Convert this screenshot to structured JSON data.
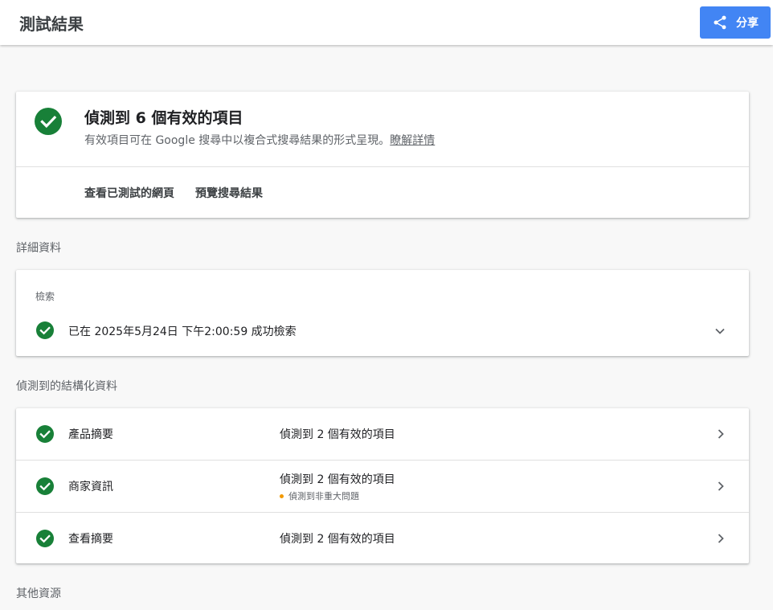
{
  "header": {
    "title": "測試結果",
    "share_label": "分享"
  },
  "summary": {
    "headline": "偵測到 6 個有效的項目",
    "description": "有效項目可在 Google 搜尋中以複合式搜尋結果的形式呈現。",
    "learn_more": "瞭解詳情",
    "actions": [
      "查看已測試的網頁",
      "預覽搜尋結果"
    ]
  },
  "details": {
    "section_label": "詳細資料",
    "crawl_label": "檢索",
    "crawl_status": "已在 2025年5月24日 下午2:00:59 成功檢索"
  },
  "structured_data": {
    "section_label": "偵測到的結構化資料",
    "rows": [
      {
        "name": "產品摘要",
        "status": "偵測到 2 個有效的項目",
        "warning": ""
      },
      {
        "name": "商家資訊",
        "status": "偵測到 2 個有效的項目",
        "warning": "偵測到非重大問題"
      },
      {
        "name": "查看摘要",
        "status": "偵測到 2 個有效的項目",
        "warning": ""
      }
    ]
  },
  "other": {
    "section_label": "其他資源"
  },
  "colors": {
    "accent": "#4285f4",
    "success": "#188038",
    "warning": "#f29900"
  }
}
